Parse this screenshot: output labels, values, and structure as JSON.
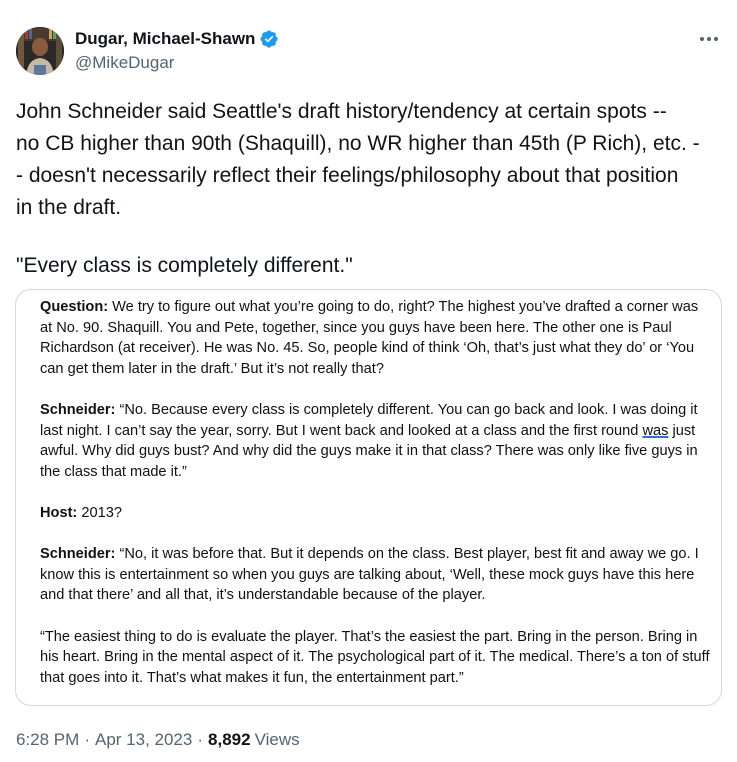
{
  "author": {
    "display_name": "Dugar, Michael-Shawn",
    "handle": "@MikeDugar",
    "verified_color": "#1d9bf0",
    "avatar_icon": "avatar-photo"
  },
  "more_icon": "more-icon",
  "tweet": {
    "line1": "John Schneider said Seattle's draft history/tendency at certain spots --",
    "line2": "no CB higher than 90th (Shaquill), no WR higher than 45th (P Rich), etc. -",
    "line3": "- doesn't necessarily reflect their feelings/philosophy about that position",
    "line4": "in the draft.",
    "line5": "\"Every class is completely different.\""
  },
  "document": {
    "q_label": "Question:",
    "q_text": " We try to figure out what you’re going to do, right? The highest you’ve drafted a corner was at No. 90. Shaquill. You and Pete, together, since you guys have been here. The other one is Paul Richardson (at receiver). He was No. 45. So, people kind of think ‘Oh, that’s just what they do’ or ‘You can get them later in the draft.’ But it’s not really that?",
    "s1_label": "Schneider:",
    "s1_text_a": " “No. Because every class is completely different. You can go back and look. I was doing it last night. I can’t say the year, sorry. But I went back and looked at a class and the first round ",
    "s1_underlined": "was",
    "s1_text_b": " just awful. Why did guys bust? And why did the guys make it in that class? There was only like five guys in the class that made it.”",
    "host_label": "Host:",
    "host_text": " 2013?",
    "s2_label": "Schneider:",
    "s2_text": " “No, it was before that. But it depends on the class. Best player, best fit and away we go. I know this is entertainment so when you guys are talking about, ‘Well, these mock guys have this here and that there’ and all that, it’s understandable because of the player.",
    "s3_text": "“The easiest thing to do is evaluate the player. That’s the easiest the part. Bring in the person. Bring in his heart. Bring in the mental aspect of it. The psychological part of it. The medical. There’s a ton of stuff that goes into it. That’s what makes it fun, the entertainment part.”"
  },
  "meta": {
    "time": "6:28 PM",
    "separator": "·",
    "date": "Apr 13, 2023",
    "views_count": "8,892",
    "views_label": "Views"
  }
}
